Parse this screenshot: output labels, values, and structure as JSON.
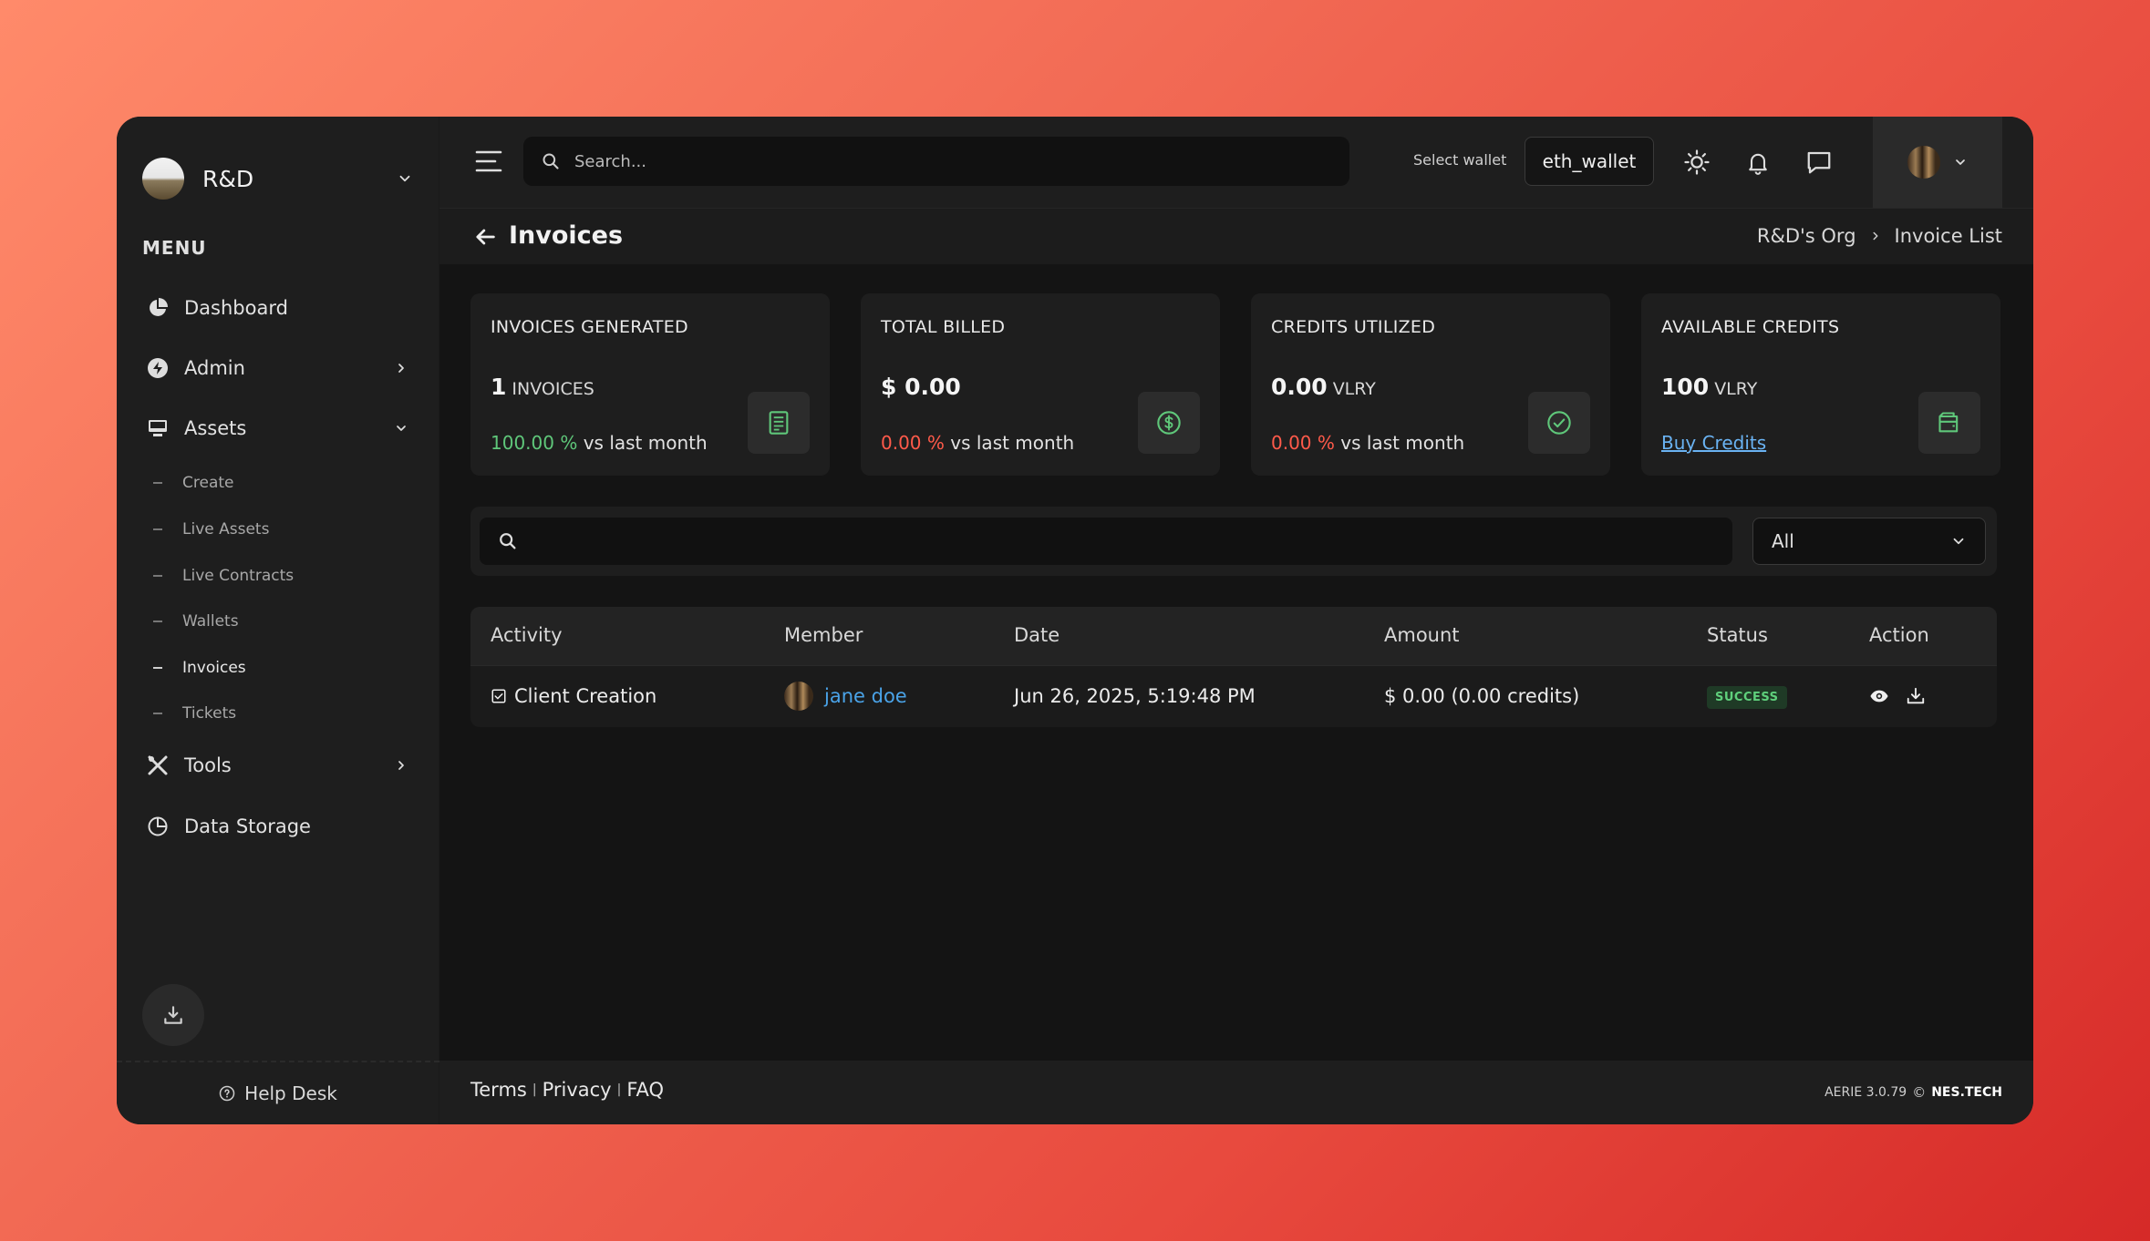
{
  "sidebar": {
    "org_name": "R&D",
    "menu_label": "MENU",
    "items": [
      {
        "label": "Dashboard",
        "icon": "pie-chart-icon"
      },
      {
        "label": "Admin",
        "icon": "bolt-icon"
      },
      {
        "label": "Assets",
        "icon": "monitor-icon"
      },
      {
        "label": "Tools",
        "icon": "tools-icon"
      },
      {
        "label": "Data Storage",
        "icon": "storage-icon"
      }
    ],
    "sub_items": [
      "Create",
      "Live Assets",
      "Live Contracts",
      "Wallets",
      "Invoices",
      "Tickets"
    ],
    "active_sub": "Invoices",
    "help_desk": "Help Desk"
  },
  "topbar": {
    "search_placeholder": "Search...",
    "wallet_label": "Select wallet",
    "wallet_value": "eth_wallet"
  },
  "page": {
    "title": "Invoices",
    "breadcrumb": [
      "R&D's Org",
      "Invoice List"
    ]
  },
  "stats": [
    {
      "title": "INVOICES GENERATED",
      "value": "1",
      "unit": "INVOICES",
      "pct": "100.00 %",
      "trend_text": "vs last month",
      "trend": "up"
    },
    {
      "title": "TOTAL BILLED",
      "value": "$ 0.00",
      "unit": "",
      "pct": "0.00 %",
      "trend_text": "vs last month",
      "trend": "down"
    },
    {
      "title": "CREDITS UTILIZED",
      "value": "0.00",
      "unit": "VLRY",
      "pct": "0.00 %",
      "trend_text": "vs last month",
      "trend": "down"
    },
    {
      "title": "AVAILABLE CREDITS",
      "value": "100",
      "unit": "VLRY",
      "link": "Buy Credits"
    }
  ],
  "filter": {
    "search_placeholder": "",
    "select_value": "All"
  },
  "table": {
    "columns": [
      "Activity",
      "Member",
      "Date",
      "Amount",
      "Status",
      "Action"
    ],
    "rows": [
      {
        "activity": "Client Creation",
        "member": "jane doe",
        "date": "Jun 26, 2025, 5:19:48 PM",
        "amount": "$ 0.00 (0.00 credits)",
        "status": "SUCCESS"
      }
    ]
  },
  "footer": {
    "links": [
      "Terms",
      "Privacy",
      "FAQ"
    ],
    "version": "AERIE 3.0.79",
    "copyright_symbol": "©",
    "brand": "NES.TECH"
  },
  "colors": {
    "accent_green": "#5fc77a",
    "accent_red": "#ff5a4a",
    "link_blue": "#4aa3e8"
  }
}
